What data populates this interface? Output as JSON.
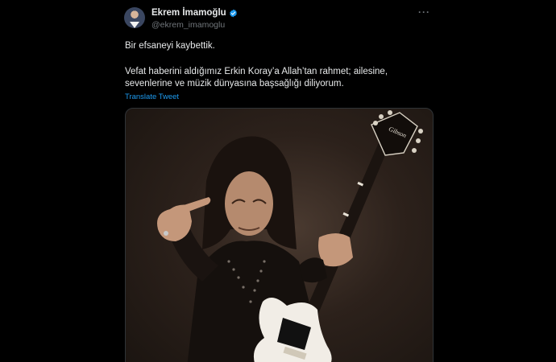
{
  "tweet": {
    "display_name": "Ekrem İmamoğlu",
    "handle": "@ekrem_imamoglu",
    "text_line1": "Bir efsaneyi kaybettik.",
    "text_line2": "Vefat haberini aldığımız Erkin Koray’a Allah’tan rahmet; ailesine, sevenlerine ve müzik dünyasına başsağlığı diliyorum.",
    "translate_label": "Translate Tweet",
    "more_label": "···",
    "guitar_brand": "Gibson"
  },
  "icons": {
    "verified": "verified-badge-icon",
    "more": "more-options-icon"
  },
  "colors": {
    "background": "#000000",
    "text": "#e7e9ea",
    "secondary_text": "#71767b",
    "link": "#1d9bf0",
    "verified": "#1d9bf0"
  }
}
